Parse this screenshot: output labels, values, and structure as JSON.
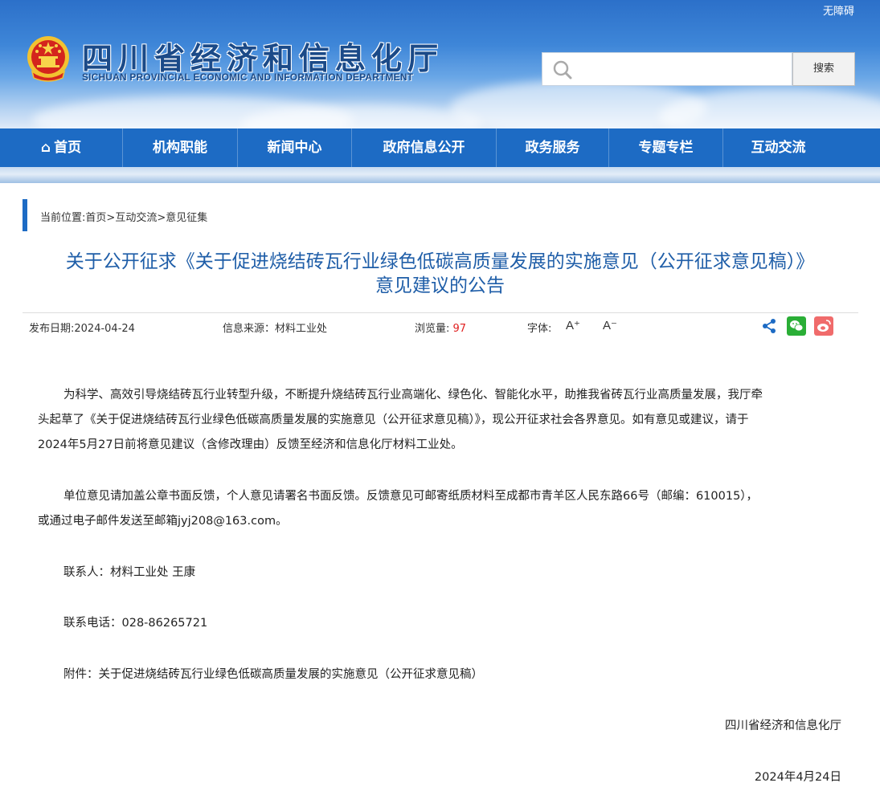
{
  "header": {
    "accessibility_label": "无障碍",
    "title_cn": "四川省经济和信息化厅",
    "title_en": "SICHUAN PROVINCIAL ECONOMIC AND INFORMATION DEPARTMENT",
    "search_placeholder": "",
    "search_button": "搜索"
  },
  "nav": {
    "items": [
      "首页",
      "机构职能",
      "新闻中心",
      "政府信息公开",
      "政务服务",
      "专题专栏",
      "互动交流"
    ]
  },
  "breadcrumb": {
    "prefix": "当前位置:",
    "items": [
      "首页",
      "互动交流",
      "意见征集"
    ],
    "separator": ">"
  },
  "article": {
    "title_line1": "关于公开征求《关于促进烧结砖瓦行业绿色低碳高质量发展的实施意见（公开征求意见稿）》",
    "title_line2": "意见建议的公告",
    "meta": {
      "date_label": "发布日期:2024-04-24",
      "source_label": "信息来源：",
      "source": "材料工业处",
      "views_label": "浏览量:",
      "views": "97",
      "font_label": "字体:",
      "font_up": "A⁺",
      "font_down": "A⁻"
    },
    "para1_line1": "为科学、高效引导烧结砖瓦行业转型升级，不断提升烧结砖瓦行业高端化、绿色化、智能化水平，助推我省砖瓦行业高质量发展，我厅牵",
    "para1_line2": "头起草了《关于促进烧结砖瓦行业绿色低碳高质量发展的实施意见（公开征求意见稿）》，现公开征求社会各界意见。如有意见或建议，请于",
    "para1_line3": "2024年5月27日前将意见建议（含修改理由）反馈至经济和信息化厅材料工业处。",
    "para2_line1": "单位意见请加盖公章书面反馈，个人意见请署名书面反馈。反馈意见可邮寄纸质材料至成都市青羊区人民东路66号（邮编：610015），",
    "para2_line2": "或通过电子邮件发送至邮箱jyj208@163.com。",
    "contact": "联系人：材料工业处 王康",
    "phone": "联系电话：028-86265721",
    "attachment_label": "附件：",
    "attachment_link": "关于促进烧结砖瓦行业绿色低碳高质量发展的实施意见（公开征求意见稿）",
    "signature": "四川省经济和信息化厅",
    "sign_date": "2024年4月24日"
  },
  "colors": {
    "primary": "#1d6bc4",
    "title": "#1f5ea8",
    "wechat": "#2aae36",
    "weibo": "#f06b6b"
  }
}
